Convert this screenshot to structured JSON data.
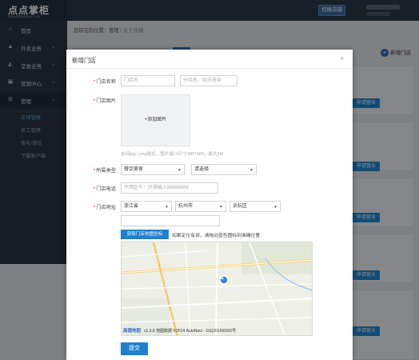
{
  "header": {
    "logo_text": "点点掌柜",
    "logo_url": "mai.ddtaobao.com",
    "switch_button": "切换店铺"
  },
  "sidebar": {
    "items": [
      {
        "label": "首页",
        "icon": "home-icon"
      },
      {
        "label": "外卖业务",
        "icon": "delivery-icon"
      },
      {
        "label": "堂食业务",
        "icon": "dine-in-icon"
      },
      {
        "label": "营销中心",
        "icon": "gift-icon"
      },
      {
        "label": "管理",
        "icon": "gear-icon"
      }
    ],
    "subitems": [
      "店铺管理",
      "员工管理",
      "帐号/协议",
      "下载客户端"
    ]
  },
  "breadcrumb": {
    "prefix": "您现在的位置：",
    "level1": "管理",
    "separator": "/",
    "level2": "关于店铺"
  },
  "page": {
    "add_store_label": "新增门店",
    "apply_label": "申请营业"
  },
  "modal": {
    "title": "新增门店",
    "close": "×",
    "store_name_label": "门店名称",
    "store_name_placeholder": "门店名",
    "branch_placeholder": "分店名，如王府井",
    "store_image_label": "门店图片",
    "upload_label": "+添加图片",
    "image_hint": "支持jpg / png格式，图片最小尺寸480*480，最大5M",
    "category_label": "所属类型",
    "category_value": "餐饮美食",
    "category_sub": "请选择",
    "phone_label": "门店电话",
    "phone_placeholder": "不用区号：只需输入88888888",
    "address_label": "门店地址",
    "province": "浙江省",
    "city": "杭州市",
    "district": "余杭区",
    "map_button": "获取门店地图坐标",
    "map_hint": "如果定位有误，请拖动蓝色图标到准确位置",
    "map_logo": "高德地图",
    "map_copyright": "v1.3.6 地图数据 ©2014 AutoNavi - GS(2014)6002号",
    "submit": "提交"
  }
}
